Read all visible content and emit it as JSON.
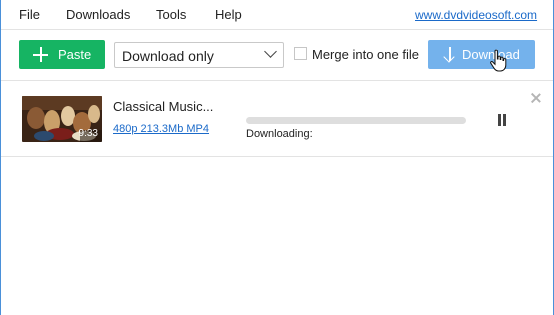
{
  "menu": {
    "file": "File",
    "downloads": "Downloads",
    "tools": "Tools",
    "help": "Help",
    "site_link": "www.dvdvideosoft.com"
  },
  "toolbar": {
    "paste_label": "Paste",
    "mode_value": "Download only",
    "merge_label": "Merge into one file",
    "merge_checked": false,
    "download_label": "Download",
    "paste_color": "#16b463",
    "download_color": "#74b2ec"
  },
  "downloads": [
    {
      "title": "Classical Music...",
      "duration": "9:33",
      "format": "480p 213.3Mb MP4",
      "status": "Downloading:",
      "progress": 0
    }
  ],
  "icons": {
    "paste": "plus-icon",
    "download": "arrow-down-icon",
    "pause": "pause-icon",
    "close": "close-icon",
    "dropdown": "chevron-down-icon",
    "cursor": "hand-pointer-icon"
  }
}
